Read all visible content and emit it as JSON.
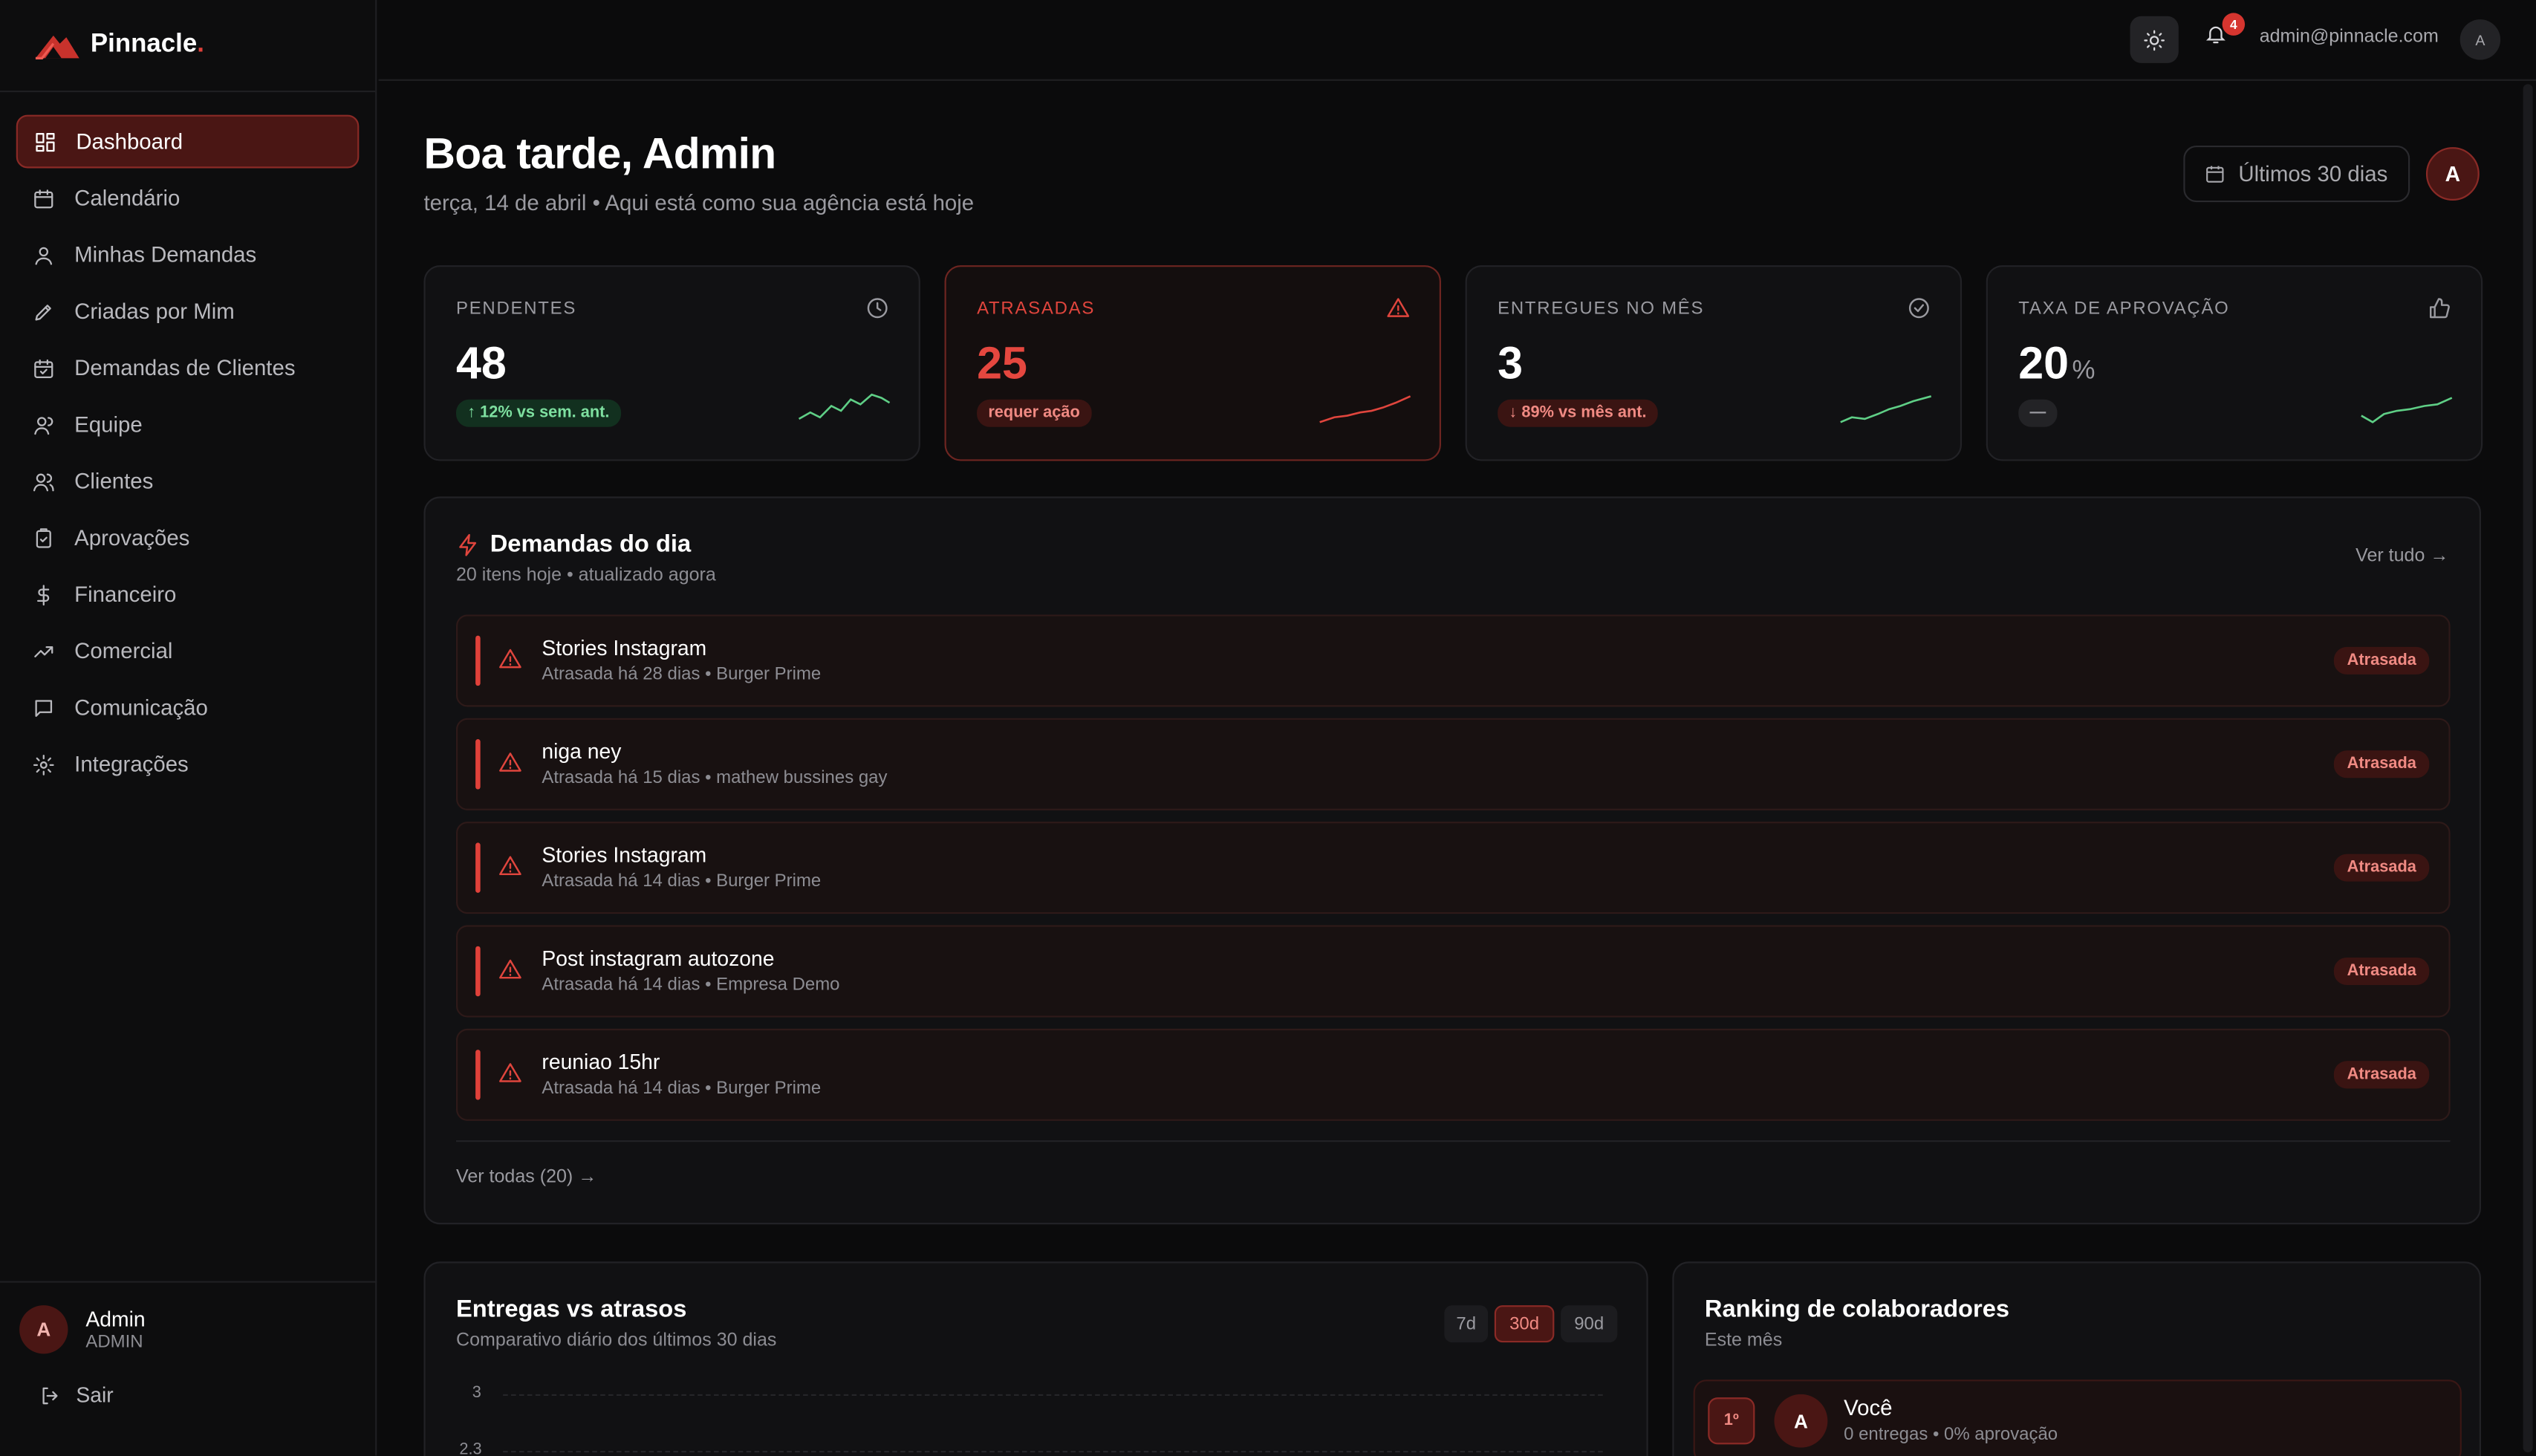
{
  "brand": {
    "name": "Pinnacle",
    "dot": ".",
    "accent": "#e0413a"
  },
  "sidebar": {
    "items": [
      {
        "label": "Dashboard",
        "icon": "grid-icon"
      },
      {
        "label": "Calendário",
        "icon": "calendar-icon"
      },
      {
        "label": "Minhas Demandas",
        "icon": "user-icon"
      },
      {
        "label": "Criadas por Mim",
        "icon": "pencil-icon"
      },
      {
        "label": "Demandas de Clientes",
        "icon": "calendar-check-icon"
      },
      {
        "label": "Equipe",
        "icon": "users-icon"
      },
      {
        "label": "Clientes",
        "icon": "users-group-icon"
      },
      {
        "label": "Aprovações",
        "icon": "clipboard-check-icon"
      },
      {
        "label": "Financeiro",
        "icon": "dollar-icon"
      },
      {
        "label": "Comercial",
        "icon": "trending-up-icon"
      },
      {
        "label": "Comunicação",
        "icon": "message-icon"
      },
      {
        "label": "Integrações",
        "icon": "gear-icon"
      }
    ],
    "user": {
      "initial": "A",
      "name": "Admin",
      "role": "ADMIN"
    },
    "logout_label": "Sair"
  },
  "topbar": {
    "notification_count": "4",
    "email": "admin@pinnacle.com",
    "avatar_initial": "A"
  },
  "header": {
    "greeting": "Boa tarde, Admin",
    "subtitle": "terça, 14 de abril • Aqui está como sua agência está hoje",
    "range_label": "Últimos 30 dias",
    "avatar_initial": "A"
  },
  "kpis": [
    {
      "label": "PENDENTES",
      "value": "48",
      "suffix": "",
      "chip": "↑ 12% vs sem. ant.",
      "chip_tone": "green",
      "icon": "clock-icon",
      "spark_color": "#5fcf86"
    },
    {
      "label": "ATRASADAS",
      "value": "25",
      "suffix": "",
      "chip": "requer ação",
      "chip_tone": "red",
      "icon": "warning-icon",
      "spark_color": "#e0453d"
    },
    {
      "label": "ENTREGUES NO MÊS",
      "value": "3",
      "suffix": "",
      "chip": "↓ 89% vs mês ant.",
      "chip_tone": "red",
      "icon": "check-circle-icon",
      "spark_color": "#5fcf86"
    },
    {
      "label": "TAXA DE APROVAÇÃO",
      "value": "20",
      "suffix": "%",
      "chip": "—",
      "chip_tone": "gray",
      "icon": "thumbs-up-icon",
      "spark_color": "#5fcf86"
    }
  ],
  "demandas": {
    "title": "Demandas do dia",
    "subtitle": "20 itens hoje • atualizado agora",
    "see_all": "Ver tudo →",
    "footer_link": "Ver todas (20) →",
    "items": [
      {
        "title": "Stories Instagram",
        "meta": "Atrasada há 28 dias • Burger Prime",
        "status": "Atrasada"
      },
      {
        "title": "niga ney",
        "meta": "Atrasada há 15 dias • mathew bussines gay",
        "status": "Atrasada"
      },
      {
        "title": "Stories Instagram",
        "meta": "Atrasada há 14 dias • Burger Prime",
        "status": "Atrasada"
      },
      {
        "title": "Post instagram autozone",
        "meta": "Atrasada há 14 dias • Empresa Demo",
        "status": "Atrasada"
      },
      {
        "title": "reuniao 15hr",
        "meta": "Atrasada há 14 dias • Burger Prime",
        "status": "Atrasada"
      }
    ]
  },
  "entregas": {
    "title": "Entregas vs atrasos",
    "subtitle": "Comparativo diário dos últimos 30 dias",
    "ranges": [
      "7d",
      "30d",
      "90d"
    ],
    "active_range": "30d",
    "y_ticks": [
      "3",
      "2.3"
    ]
  },
  "ranking": {
    "title": "Ranking de colaboradores",
    "subtitle": "Este mês",
    "rows": [
      {
        "position": "1º",
        "initial": "A",
        "name": "Você",
        "meta": "0 entregas • 0% aprovação"
      }
    ]
  }
}
